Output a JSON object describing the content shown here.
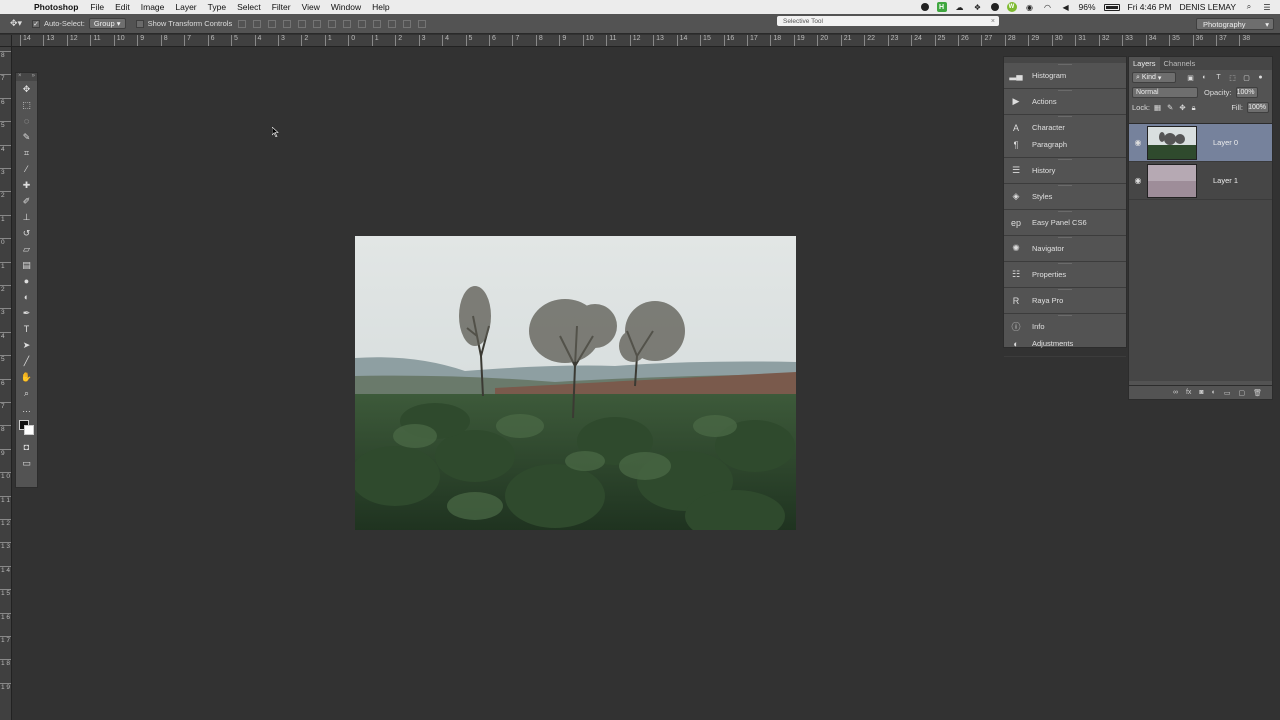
{
  "menubar": {
    "app_name": "Photoshop",
    "items": [
      "File",
      "Edit",
      "Image",
      "Layer",
      "Type",
      "Select",
      "Filter",
      "View",
      "Window",
      "Help"
    ],
    "battery": "96%",
    "clock": "Fri 4:46 PM",
    "user": "DENIS LEMAY"
  },
  "options_bar": {
    "auto_select_label": "Auto-Select:",
    "auto_select_value": "Group",
    "show_transform_label": "Show Transform Controls",
    "selective_tool_label": "Selective Tool",
    "workspace": "Photography"
  },
  "rulers": {
    "horizontal": [
      "14",
      "13",
      "12",
      "11",
      "10",
      "9",
      "8",
      "7",
      "6",
      "5",
      "4",
      "3",
      "2",
      "1",
      "0",
      "1",
      "2",
      "3",
      "4",
      "5",
      "6",
      "7",
      "8",
      "9",
      "10",
      "11",
      "12",
      "13",
      "14",
      "15",
      "16",
      "17",
      "18",
      "19",
      "20",
      "21",
      "22",
      "23",
      "24",
      "25",
      "26",
      "27",
      "28",
      "29",
      "30",
      "31",
      "32",
      "33",
      "34",
      "35",
      "36",
      "37",
      "38"
    ],
    "vertical": [
      "8",
      "7",
      "6",
      "5",
      "4",
      "3",
      "2",
      "1",
      "0",
      "1",
      "2",
      "3",
      "4",
      "5",
      "6",
      "7",
      "8",
      "9",
      "1 0",
      "1 1",
      "1 2",
      "1 3",
      "1 4",
      "1 5",
      "1 6",
      "1 7",
      "1 8",
      "1 9"
    ]
  },
  "dock": {
    "groups": [
      [
        {
          "icon": "histogram-icon",
          "label": "Histogram"
        }
      ],
      [
        {
          "icon": "actions-icon",
          "label": "Actions"
        }
      ],
      [
        {
          "icon": "character-icon",
          "label": "Character"
        },
        {
          "icon": "paragraph-icon",
          "label": "Paragraph"
        }
      ],
      [
        {
          "icon": "history-icon",
          "label": "History"
        }
      ],
      [
        {
          "icon": "styles-icon",
          "label": "Styles"
        }
      ],
      [
        {
          "icon": "easy-panel-icon",
          "label": "Easy Panel CS6"
        }
      ],
      [
        {
          "icon": "navigator-icon",
          "label": "Navigator"
        }
      ],
      [
        {
          "icon": "properties-icon",
          "label": "Properties"
        }
      ],
      [
        {
          "icon": "raya-pro-icon",
          "label": "Raya Pro"
        }
      ],
      [
        {
          "icon": "info-icon",
          "label": "Info"
        },
        {
          "icon": "adjustments-icon",
          "label": "Adjustments"
        }
      ]
    ]
  },
  "layers_panel": {
    "tabs": [
      "Layers",
      "Channels"
    ],
    "kind": "Kind",
    "blend_mode": "Normal",
    "opacity_label": "Opacity:",
    "opacity_value": "100%",
    "lock_label": "Lock:",
    "fill_label": "Fill:",
    "fill_value": "100%",
    "layers": [
      {
        "name": "Layer 0",
        "selected": true
      },
      {
        "name": "Layer 1",
        "selected": false
      }
    ]
  },
  "colors": {
    "canvas_bg": "#323232",
    "panel_bg": "#535353",
    "selected_layer": "#76829c"
  }
}
